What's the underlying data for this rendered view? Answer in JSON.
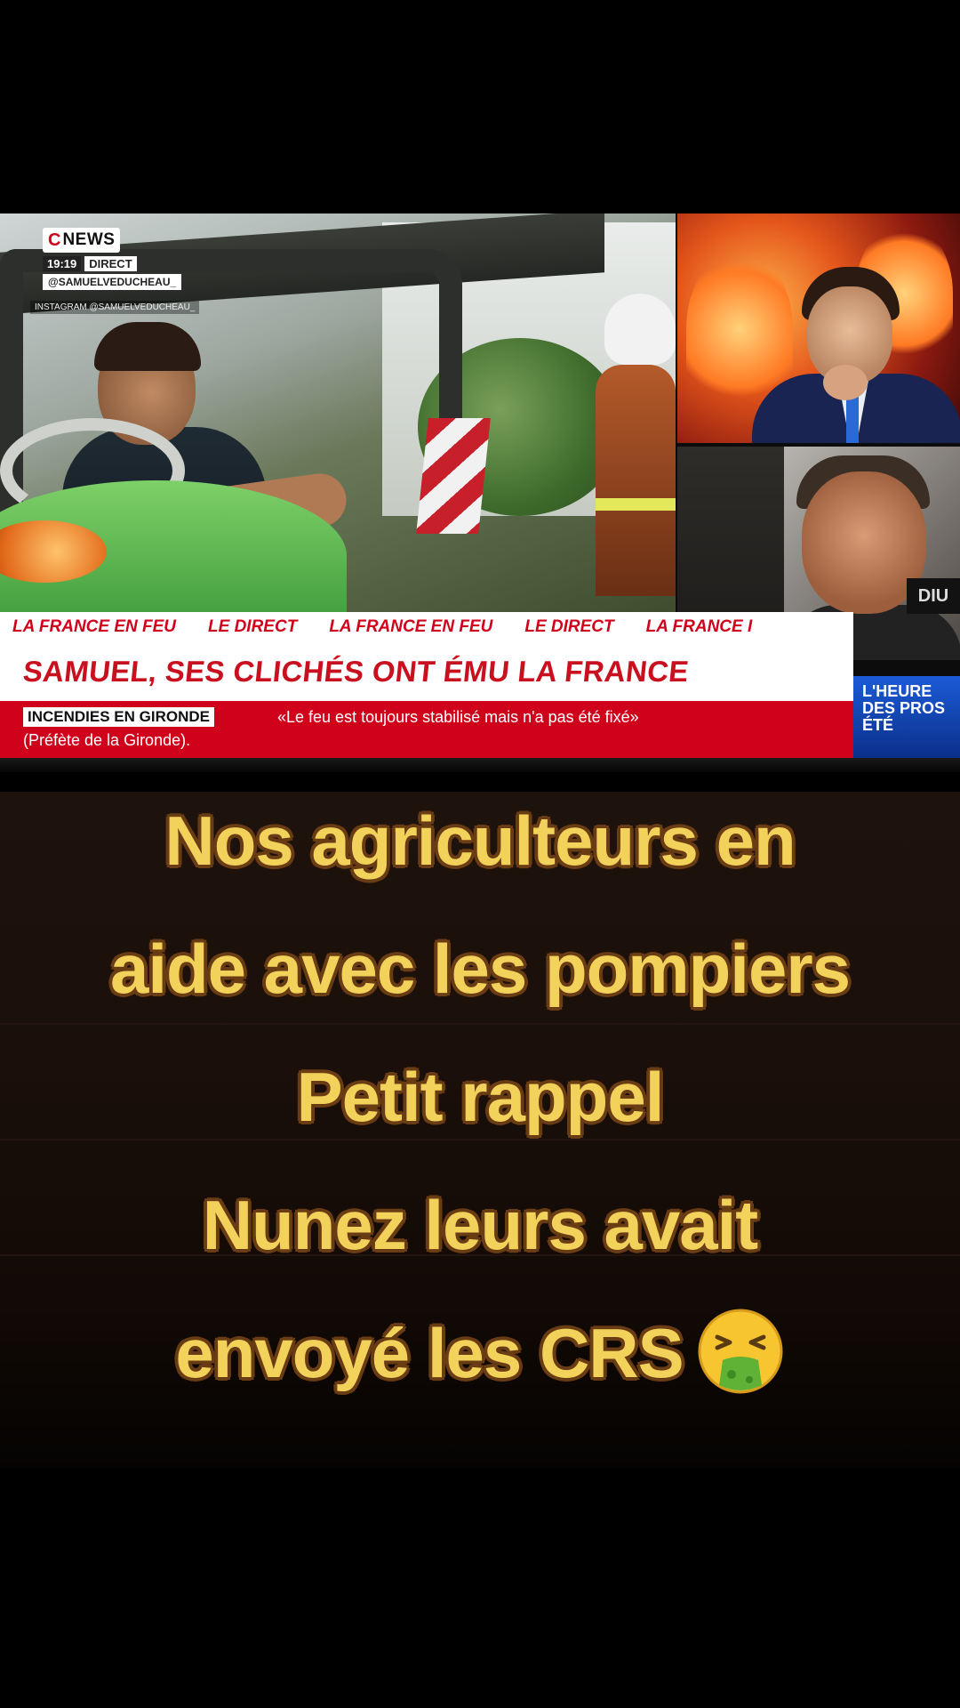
{
  "tv": {
    "channel_logo_c": "C",
    "channel_logo_news": "NEWS",
    "time": "19:19",
    "live_label": "DIRECT",
    "handle": "@SAMUELVEDUCHEAU_",
    "instagram_credit": "INSTAGRAM @SAMUELVEDUCHEAU_",
    "guest_tag": "DIU",
    "ticker_items": [
      "LA FRANCE EN FEU",
      "LE DIRECT",
      "LA FRANCE EN FEU",
      "LE DIRECT",
      "LA FRANCE I"
    ],
    "headline": "SAMUEL, SES CLICHÉS ONT ÉMU LA FRANCE",
    "sub_tag": "INCENDIES EN GIRONDE",
    "sub_quote": "«Le feu est toujours stabilisé mais n'a pas été fixé»",
    "sub_source": "(Préfète de la Gironde).",
    "show_badge_line1": "L'HEURE",
    "show_badge_line2": "DES PROS",
    "show_badge_line3": "ÉTÉ"
  },
  "caption": {
    "line1": "Nos agriculteurs en",
    "line2": "aide avec les pompiers",
    "line3": "Petit rappel",
    "line4": "Nunez leurs avait",
    "line5": "envoyé les CRS",
    "emoji": "vomiting-face-icon"
  },
  "colors": {
    "caption_text": "#f2d25a",
    "caption_outline": "#6a3c14",
    "news_red": "#d0021b",
    "badge_blue": "#1b5bd6"
  }
}
